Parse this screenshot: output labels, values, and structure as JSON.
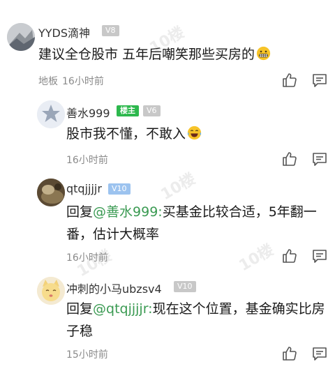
{
  "comments": [
    {
      "username": "YYDS滴神",
      "level": "V8",
      "text": "建议全仓股市 五年后嘲笑那些买房的",
      "floor": "地板",
      "time": "16小时前"
    },
    {
      "username": "善水999",
      "owner_badge": "楼主",
      "level": "V6",
      "text": "股市我不懂，不敢入",
      "time": "16小时前"
    },
    {
      "username": "qtqjjjjr",
      "level": "V10",
      "reply_prefix": "回复",
      "mention": "@善水999:",
      "text": "买基金比较合适，5年翻一番，估计大概率",
      "time": "16小时前"
    },
    {
      "username": "冲刺的小马ubzsv4",
      "level": "V10",
      "reply_prefix": "回复",
      "mention": "@qtqjjjjr:",
      "text": "现在这个位置，基金确实比房子稳",
      "time": "15小时前"
    }
  ],
  "icons": {
    "like": "thumbs-up-icon",
    "reply": "comment-bubble-icon",
    "emoji_grimace": "grimacing-face-icon",
    "emoji_laugh": "laughing-tears-face-icon"
  },
  "colors": {
    "mention": "#3a9a52",
    "owner_badge": "#2db84d",
    "level_badge": "#c8c8c8",
    "level_badge_blue": "#9cc3ef",
    "meta_text": "#8a8a8a"
  }
}
